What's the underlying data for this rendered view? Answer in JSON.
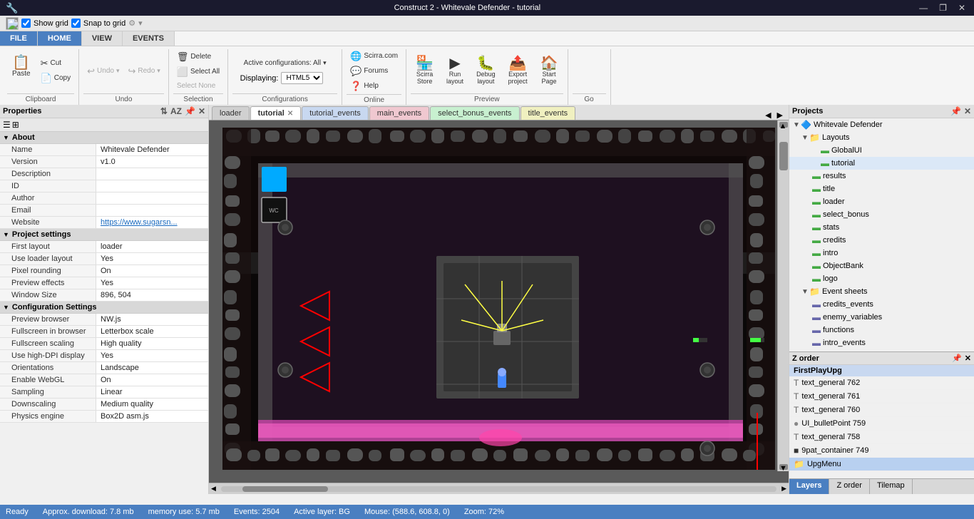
{
  "titlebar": {
    "title": "Construct 2 - Whitevale Defender - tutorial",
    "app_name": "Construct 2",
    "project": "Whitevale Defender",
    "layout": "tutorial",
    "min_btn": "—",
    "max_btn": "❐",
    "close_btn": "✕"
  },
  "topbar": {
    "show_grid_label": "Show grid",
    "snap_to_grid_label": "Snap to grid",
    "show_grid_checked": true,
    "snap_to_grid_checked": true
  },
  "ribbon": {
    "tabs": [
      {
        "id": "file",
        "label": "FILE",
        "active": false
      },
      {
        "id": "home",
        "label": "HOME",
        "active": true
      },
      {
        "id": "view",
        "label": "VIEW",
        "active": false
      },
      {
        "id": "events",
        "label": "EVENTS",
        "active": false
      }
    ],
    "clipboard_group": {
      "label": "Clipboard",
      "paste_label": "Paste",
      "cut_label": "Cut",
      "copy_label": "Copy",
      "undo_label": "Undo",
      "redo_label": "Redo"
    },
    "selection_group": {
      "label": "Selection",
      "delete_label": "Delete",
      "select_all_label": "Select All",
      "select_none_label": "Select None"
    },
    "configurations_group": {
      "label": "Configurations",
      "active_label": "Active configurations: All",
      "displaying_label": "Displaying:",
      "html5_value": "HTML5"
    },
    "online_group": {
      "label": "Online",
      "scirra_com": "Scirra.com",
      "forums": "Forums",
      "help": "Help"
    },
    "preview_group": {
      "label": "Preview",
      "scirra_store": "Scirra\nStore",
      "run_layout": "Run\nlayout",
      "debug_layout": "Debug\nlayout",
      "export_project": "Export\nproject",
      "start_page": "Start\nPage"
    }
  },
  "layout_tabs": [
    {
      "id": "loader",
      "label": "loader",
      "active": false,
      "type": "layout",
      "closeable": false
    },
    {
      "id": "tutorial",
      "label": "tutorial",
      "active": true,
      "type": "layout",
      "closeable": true
    },
    {
      "id": "tutorial_events",
      "label": "tutorial_events",
      "active": false,
      "type": "events",
      "color": "blue",
      "closeable": false
    },
    {
      "id": "main_events",
      "label": "main_events",
      "active": false,
      "type": "events",
      "color": "pink",
      "closeable": false
    },
    {
      "id": "select_bonus_events",
      "label": "select_bonus_events",
      "active": false,
      "type": "events",
      "color": "green",
      "closeable": false
    },
    {
      "id": "title_events",
      "label": "title_events",
      "active": false,
      "type": "events",
      "color": "yellow",
      "closeable": false
    }
  ],
  "properties": {
    "header": "Properties",
    "sections": [
      {
        "id": "about",
        "label": "About",
        "expanded": true,
        "rows": [
          {
            "key": "Name",
            "value": "Whitevale Defender"
          },
          {
            "key": "Version",
            "value": "v1.0"
          },
          {
            "key": "Description",
            "value": ""
          },
          {
            "key": "ID",
            "value": ""
          },
          {
            "key": "Author",
            "value": ""
          },
          {
            "key": "Email",
            "value": ""
          },
          {
            "key": "Website",
            "value": "https://www.sugarsn..."
          }
        ]
      },
      {
        "id": "project_settings",
        "label": "Project settings",
        "expanded": true,
        "rows": [
          {
            "key": "First layout",
            "value": "loader"
          },
          {
            "key": "Use loader layout",
            "value": "Yes"
          },
          {
            "key": "Pixel rounding",
            "value": "On"
          },
          {
            "key": "Preview effects",
            "value": "Yes"
          },
          {
            "key": "Window Size",
            "value": "896, 504"
          }
        ]
      },
      {
        "id": "configuration_settings",
        "label": "Configuration Settings",
        "expanded": true,
        "rows": [
          {
            "key": "Preview browser",
            "value": "NW.js"
          },
          {
            "key": "Fullscreen in browser",
            "value": "Letterbox scale"
          },
          {
            "key": "Fullscreen scaling",
            "value": "High quality"
          },
          {
            "key": "Use high-DPI display",
            "value": "Yes"
          },
          {
            "key": "Orientations",
            "value": "Landscape"
          },
          {
            "key": "Enable WebGL",
            "value": "On"
          },
          {
            "key": "Sampling",
            "value": "Linear"
          },
          {
            "key": "Downscaling",
            "value": "Medium quality"
          },
          {
            "key": "Physics engine",
            "value": "Box2D asm.js"
          }
        ]
      }
    ]
  },
  "projects_panel": {
    "header": "Projects",
    "root": "Whitevale Defender",
    "layouts_label": "Layouts",
    "layouts": [
      {
        "name": "GlobalUI"
      },
      {
        "name": "tutorial"
      },
      {
        "name": "results"
      },
      {
        "name": "title"
      },
      {
        "name": "loader"
      },
      {
        "name": "select_bonus"
      },
      {
        "name": "stats"
      },
      {
        "name": "credits"
      },
      {
        "name": "intro"
      },
      {
        "name": "ObjectBank"
      },
      {
        "name": "logo"
      }
    ],
    "event_sheets_label": "Event sheets",
    "event_sheets": [
      {
        "name": "credits_events"
      },
      {
        "name": "enemy_variables"
      },
      {
        "name": "functions"
      },
      {
        "name": "intro_events"
      }
    ]
  },
  "zorder_panel": {
    "header": "Z order",
    "active_layer": "FirstPlayUpg",
    "items": [
      {
        "label": "text_general 762",
        "type": "text"
      },
      {
        "label": "text_general 761",
        "type": "text"
      },
      {
        "label": "text_general 760",
        "type": "text"
      },
      {
        "label": "UI_bulletPoint 759",
        "type": "circle"
      },
      {
        "label": "text_general 758",
        "type": "text"
      },
      {
        "label": "9pat_container 749",
        "type": "square"
      },
      {
        "label": "UpgMenu",
        "type": "folder"
      }
    ]
  },
  "bottom_tabs": {
    "layers": "Layers",
    "z_order": "Z order",
    "tilemap": "Tilemap"
  },
  "statusbar": {
    "ready": "Ready",
    "download": "Approx. download: 7.8 mb",
    "memory": "memory use: 5.7 mb",
    "events": "Events: 2504",
    "active_layer": "Active layer: BG",
    "mouse": "Mouse: (588.6, 608.8, 0)",
    "zoom": "Zoom: 72%"
  }
}
